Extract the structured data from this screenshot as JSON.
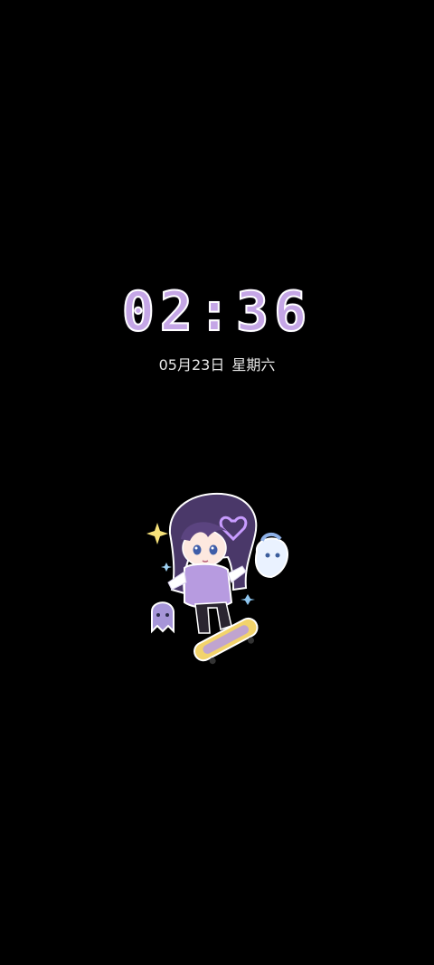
{
  "lockscreen": {
    "time": "02:36",
    "date": "05月23日",
    "weekday": "星期六"
  },
  "wallpaper": {
    "subject": "chibi-character-on-skateboard-sticker",
    "colors": {
      "background": "#000000",
      "clock_fill": "#c5a6e6",
      "clock_outline": "#ffffff",
      "hair": "#4a3869",
      "sweater": "#b79be0",
      "skateboard": "#f2d36b"
    }
  }
}
